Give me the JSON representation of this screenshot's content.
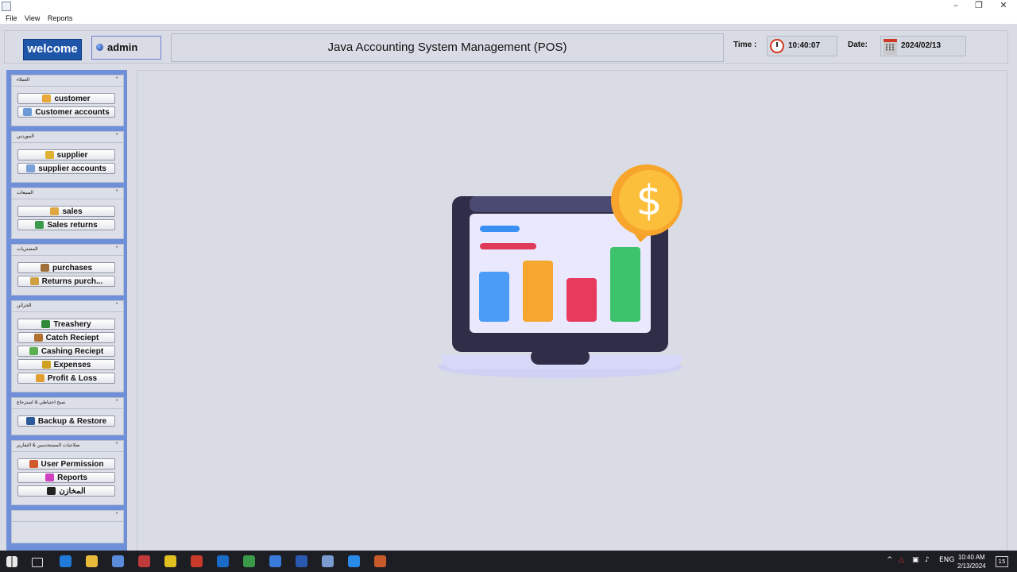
{
  "menu": [
    "File",
    "View",
    "Reports"
  ],
  "window_controls": {
    "minimize": "–",
    "restore": "❐",
    "close": "✕"
  },
  "header": {
    "welcome": "welcome",
    "user": "admin",
    "title": "Java Accounting System Management (POS)",
    "time_label": "Time :",
    "time": "10:40:07",
    "date_label": "Date:",
    "date": "2024/02/13"
  },
  "sidebar": {
    "groups": [
      {
        "title": "العملاء",
        "buttons": [
          {
            "label": "customer",
            "icon": "customer-icon",
            "color": "#e8a83a"
          },
          {
            "label": "Customer accounts",
            "icon": "customer-accounts-icon",
            "color": "#6a9ad8"
          }
        ]
      },
      {
        "title": "الموردين",
        "buttons": [
          {
            "label": "supplier",
            "icon": "supplier-icon",
            "color": "#e0b030"
          },
          {
            "label": "supplier accounts",
            "icon": "supplier-accounts-icon",
            "color": "#7aa0d8"
          }
        ]
      },
      {
        "title": "المبيعات",
        "buttons": [
          {
            "label": "sales",
            "icon": "sales-icon",
            "color": "#e0a840"
          },
          {
            "label": "Sales returns",
            "icon": "sales-returns-icon",
            "color": "#3a9a4a"
          }
        ]
      },
      {
        "title": "المشتريات",
        "buttons": [
          {
            "label": "purchases",
            "icon": "purchases-icon",
            "color": "#a0703a"
          },
          {
            "label": "Returns purch...",
            "icon": "returns-purchases-icon",
            "color": "#d0a040"
          }
        ]
      },
      {
        "title": "الخزائن",
        "buttons": [
          {
            "label": "Treashery",
            "icon": "treasury-icon",
            "color": "#2e8a3a"
          },
          {
            "label": "Catch Reciept",
            "icon": "catch-receipt-icon",
            "color": "#b07030"
          },
          {
            "label": "Cashing Reciept",
            "icon": "cashing-receipt-icon",
            "color": "#5ab050"
          },
          {
            "label": "Expenses",
            "icon": "expenses-icon",
            "color": "#d0a020"
          },
          {
            "label": "Profit & Loss",
            "icon": "profit-loss-icon",
            "color": "#e0a030"
          }
        ]
      },
      {
        "title": "نسخ احتياطي & استرجاع",
        "buttons": [
          {
            "label": "Backup & Restore",
            "icon": "backup-icon",
            "color": "#2a5a9a"
          }
        ]
      },
      {
        "title": "صلاحيات المستخدمين & التقارير",
        "buttons": [
          {
            "label": "User Permission",
            "icon": "user-permission-icon",
            "color": "#d05a2a"
          },
          {
            "label": "Reports",
            "icon": "reports-icon",
            "color": "#d040c0"
          },
          {
            "label": "المخازن",
            "icon": "warehouse-icon",
            "color": "#222222"
          }
        ]
      },
      {
        "title": "",
        "buttons": []
      }
    ]
  },
  "illustration": {
    "symbol": "$",
    "name": "laptop-bar-chart-illustration"
  },
  "taskbar": {
    "lang": "ENG",
    "time": "10:40 AM",
    "date": "2/13/2024",
    "notification_count": "15",
    "apps": [
      "edge-icon",
      "explorer-icon",
      "files-icon",
      "app-icon",
      "warning-app-icon",
      "p-app-icon",
      "outlook-icon",
      "chrome-icon",
      "vpn-icon",
      "vscode-icon",
      "box-icon",
      "zoom-icon",
      "java-icon"
    ]
  }
}
